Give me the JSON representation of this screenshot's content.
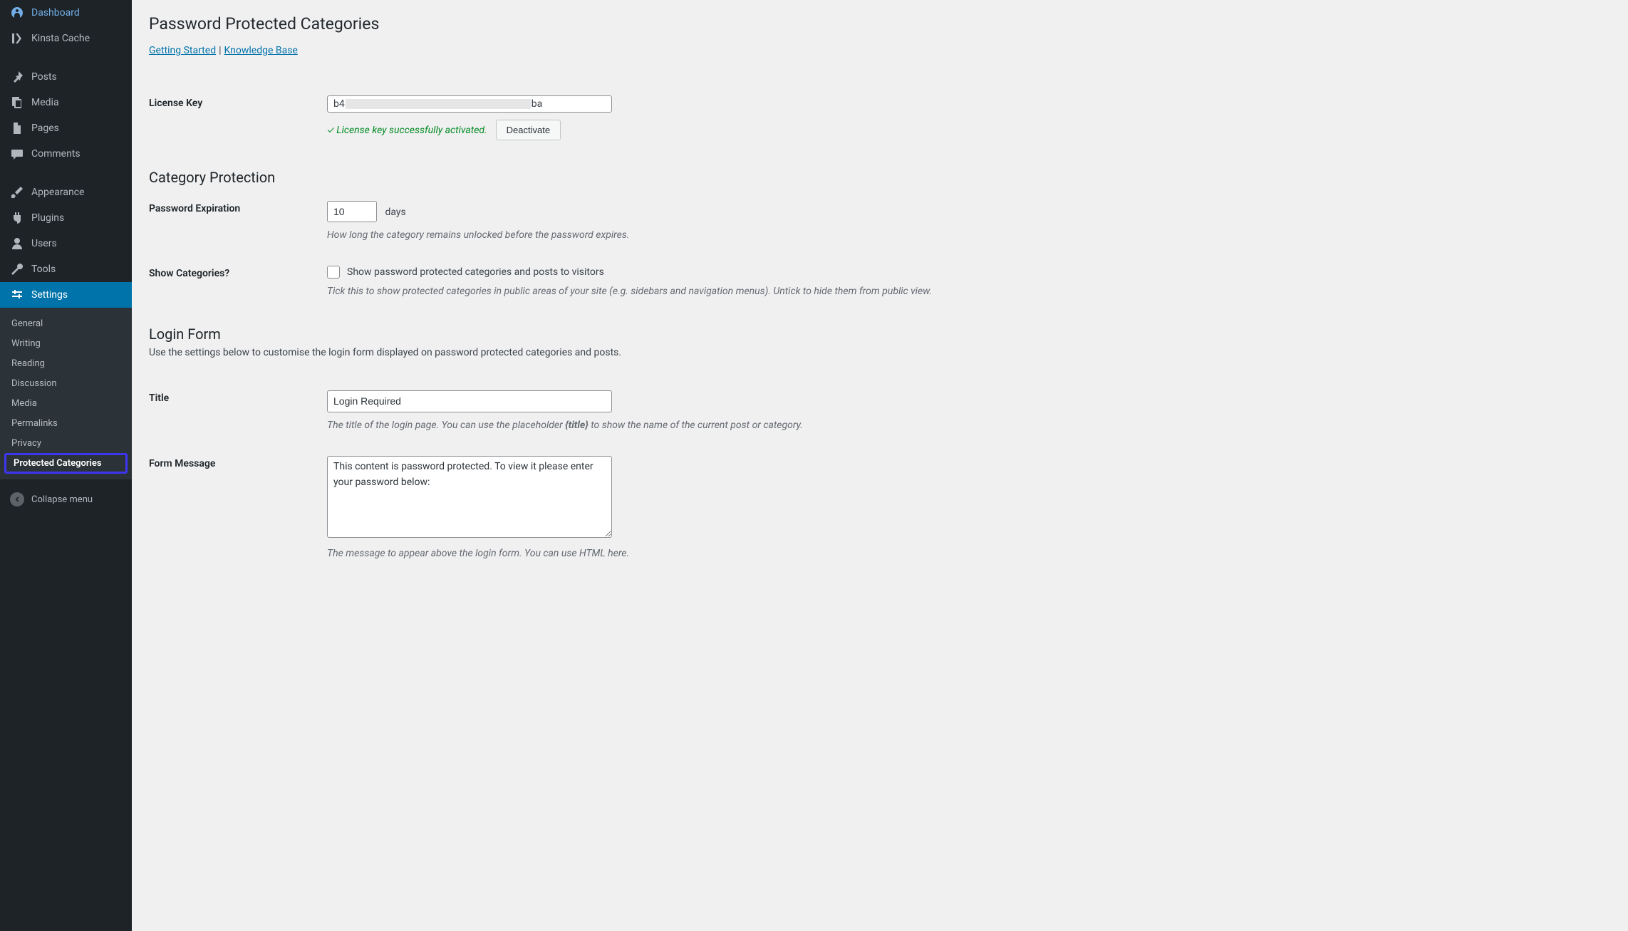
{
  "sidebar": {
    "main": [
      {
        "label": "Dashboard",
        "icon": "dashboard"
      },
      {
        "label": "Kinsta Cache",
        "icon": "kinsta"
      }
    ],
    "content": [
      {
        "label": "Posts",
        "icon": "pin"
      },
      {
        "label": "Media",
        "icon": "media"
      },
      {
        "label": "Pages",
        "icon": "pages"
      },
      {
        "label": "Comments",
        "icon": "comments"
      }
    ],
    "admin": [
      {
        "label": "Appearance",
        "icon": "appearance"
      },
      {
        "label": "Plugins",
        "icon": "plugins"
      },
      {
        "label": "Users",
        "icon": "users"
      },
      {
        "label": "Tools",
        "icon": "tools"
      },
      {
        "label": "Settings",
        "icon": "settings",
        "active": true
      }
    ],
    "submenu": [
      {
        "label": "General"
      },
      {
        "label": "Writing"
      },
      {
        "label": "Reading"
      },
      {
        "label": "Discussion"
      },
      {
        "label": "Media"
      },
      {
        "label": "Permalinks"
      },
      {
        "label": "Privacy"
      },
      {
        "label": "Protected Categories",
        "highlight": true
      }
    ],
    "collapse": "Collapse menu"
  },
  "page": {
    "title": "Password Protected Categories",
    "links": {
      "getting_started": "Getting Started",
      "knowledge_base": "Knowledge Base"
    },
    "license": {
      "th": "License Key",
      "prefix": "b4",
      "suffix": "ba",
      "status": "✓ License key successfully activated.",
      "deactivate": "Deactivate"
    },
    "cat_protection": {
      "heading": "Category Protection",
      "expiration": {
        "th": "Password Expiration",
        "value": "10",
        "unit": "days",
        "desc": "How long the category remains unlocked before the password expires."
      },
      "show": {
        "th": "Show Categories?",
        "label": "Show password protected categories and posts to visitors",
        "desc": "Tick this to show protected categories in public areas of your site (e.g. sidebars and navigation menus). Untick to hide them from public view."
      }
    },
    "login_form": {
      "heading": "Login Form",
      "desc": "Use the settings below to customise the login form displayed on password protected categories and posts.",
      "title_field": {
        "th": "Title",
        "value": "Login Required",
        "desc_a": "The title of the login page. You can use the placeholder ",
        "desc_b": "{title}",
        "desc_c": " to show the name of the current post or category."
      },
      "message": {
        "th": "Form Message",
        "value": "This content is password protected. To view it please enter your password below:",
        "desc": "The message to appear above the login form. You can use HTML here."
      }
    }
  }
}
